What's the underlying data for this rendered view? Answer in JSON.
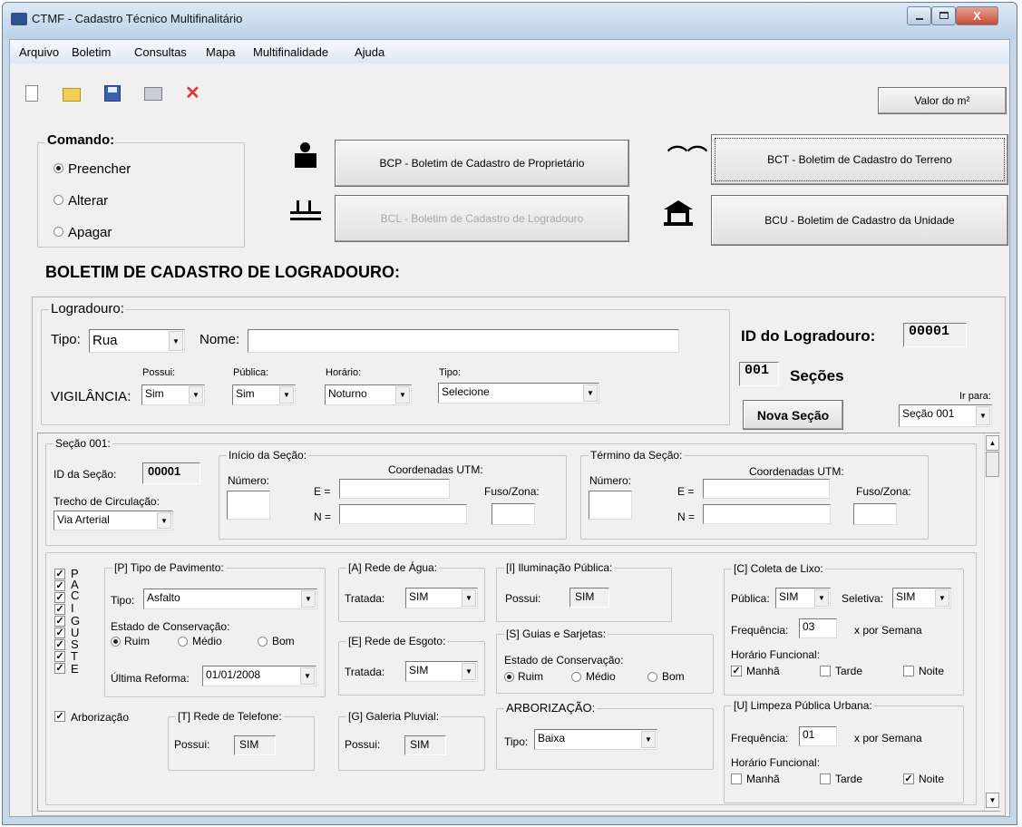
{
  "window": {
    "title": "CTMF - Cadastro Técnico Multifinalitário"
  },
  "menu": [
    "Arquivo",
    "Boletim",
    "Consultas",
    "Mapa",
    "Multifinalidade",
    "Ajuda"
  ],
  "toolbar": {
    "valor_button": "Valor do m²"
  },
  "comando": {
    "title": "Comando:",
    "options": [
      "Preencher",
      "Alterar",
      "Apagar"
    ],
    "selected": "Preencher"
  },
  "boletins": {
    "bcp": "BCP - Boletim de Cadastro de Proprietário",
    "bct": "BCT - Boletim de Cadastro do Terreno",
    "bcl": "BCL - Boletim de Cadastro de Logradouro",
    "bcu": "BCU - Boletim de Cadastro da Unidade"
  },
  "heading": "BOLETIM DE CADASTRO DE LOGRADOURO:",
  "logradouro": {
    "group": "Logradouro:",
    "tipo_label": "Tipo:",
    "tipo": "Rua",
    "nome_label": "Nome:",
    "nome": "",
    "vigilancia_label": "VIGILÂNCIA:",
    "possui_label": "Possui:",
    "possui": "Sim",
    "publica_label": "Pública:",
    "publica": "Sim",
    "horario_label": "Horário:",
    "horario": "Noturno",
    "tipo2_label": "Tipo:",
    "tipo2": "Selecione"
  },
  "id_panel": {
    "id_label": "ID do Logradouro:",
    "id": "00001",
    "secoes_count": "001",
    "secoes_label": "Seções",
    "nova_secao": "Nova Seção",
    "ir_para_label": "Ir para:",
    "ir_para": "Seção 001"
  },
  "secao": {
    "group": "Seção 001:",
    "id_label": "ID da Seção:",
    "id": "00001",
    "trecho_label": "Trecho de Circulação:",
    "trecho": "Via Arterial",
    "inicio": {
      "group": "Início da Seção:",
      "numero_label": "Número:",
      "coord_label": "Coordenadas UTM:",
      "e_label": "E =",
      "n_label": "N =",
      "fuso_label": "Fuso/Zona:"
    },
    "termino": {
      "group": "Término da Seção:",
      "numero_label": "Número:",
      "coord_label": "Coordenadas UTM:",
      "e_label": "E =",
      "n_label": "N =",
      "fuso_label": "Fuso/Zona:"
    }
  },
  "checks": {
    "letters": [
      "P",
      "A",
      "C",
      "I",
      "G",
      "U",
      "S",
      "T",
      "E"
    ],
    "arborizacao": "Arborização"
  },
  "pavimento": {
    "group": "[P] Tipo de Pavimento:",
    "tipo_label": "Tipo:",
    "tipo": "Asfalto",
    "estado_label": "Estado de Conservação:",
    "opts": [
      "Ruim",
      "Médio",
      "Bom"
    ],
    "reforma_label": "Última Reforma:",
    "reforma": "01/01/2008"
  },
  "agua": {
    "group": "[A] Rede de Água:",
    "tratada_label": "Tratada:",
    "tratada": "SIM"
  },
  "esgoto": {
    "group": "[E] Rede de Esgoto:",
    "tratada_label": "Tratada:",
    "tratada": "SIM"
  },
  "iluminacao": {
    "group": "[I] Iluminação Pública:",
    "possui_label": "Possui:",
    "possui": "SIM"
  },
  "guias": {
    "group": "[S] Guias e Sarjetas:",
    "estado_label": "Estado de Conservação:",
    "opts": [
      "Ruim",
      "Médio",
      "Bom"
    ]
  },
  "telefone": {
    "group": "[T] Rede de Telefone:",
    "possui_label": "Possui:",
    "possui": "SIM"
  },
  "galeria": {
    "group": "[G] Galeria Pluvial:",
    "possui_label": "Possui:",
    "possui": "SIM"
  },
  "arborizacao": {
    "group": "ARBORIZAÇÃO:",
    "tipo_label": "Tipo:",
    "tipo": "Baixa"
  },
  "coleta": {
    "group": "[C] Coleta de Lixo:",
    "publica_label": "Pública:",
    "publica": "SIM",
    "seletiva_label": "Seletiva:",
    "seletiva": "SIM",
    "freq_label": "Frequência:",
    "freq": "03",
    "per_semana": "x  por Semana",
    "horario_label": "Horário Funcional:",
    "opts": [
      "Manhã",
      "Tarde",
      "Noite"
    ]
  },
  "limpeza": {
    "group": "[U] Limpeza Pública Urbana:",
    "freq_label": "Frequência:",
    "freq": "01",
    "per_semana": "x  por Semana",
    "horario_label": "Horário Funcional:",
    "opts": [
      "Manhã",
      "Tarde",
      "Noite"
    ]
  }
}
